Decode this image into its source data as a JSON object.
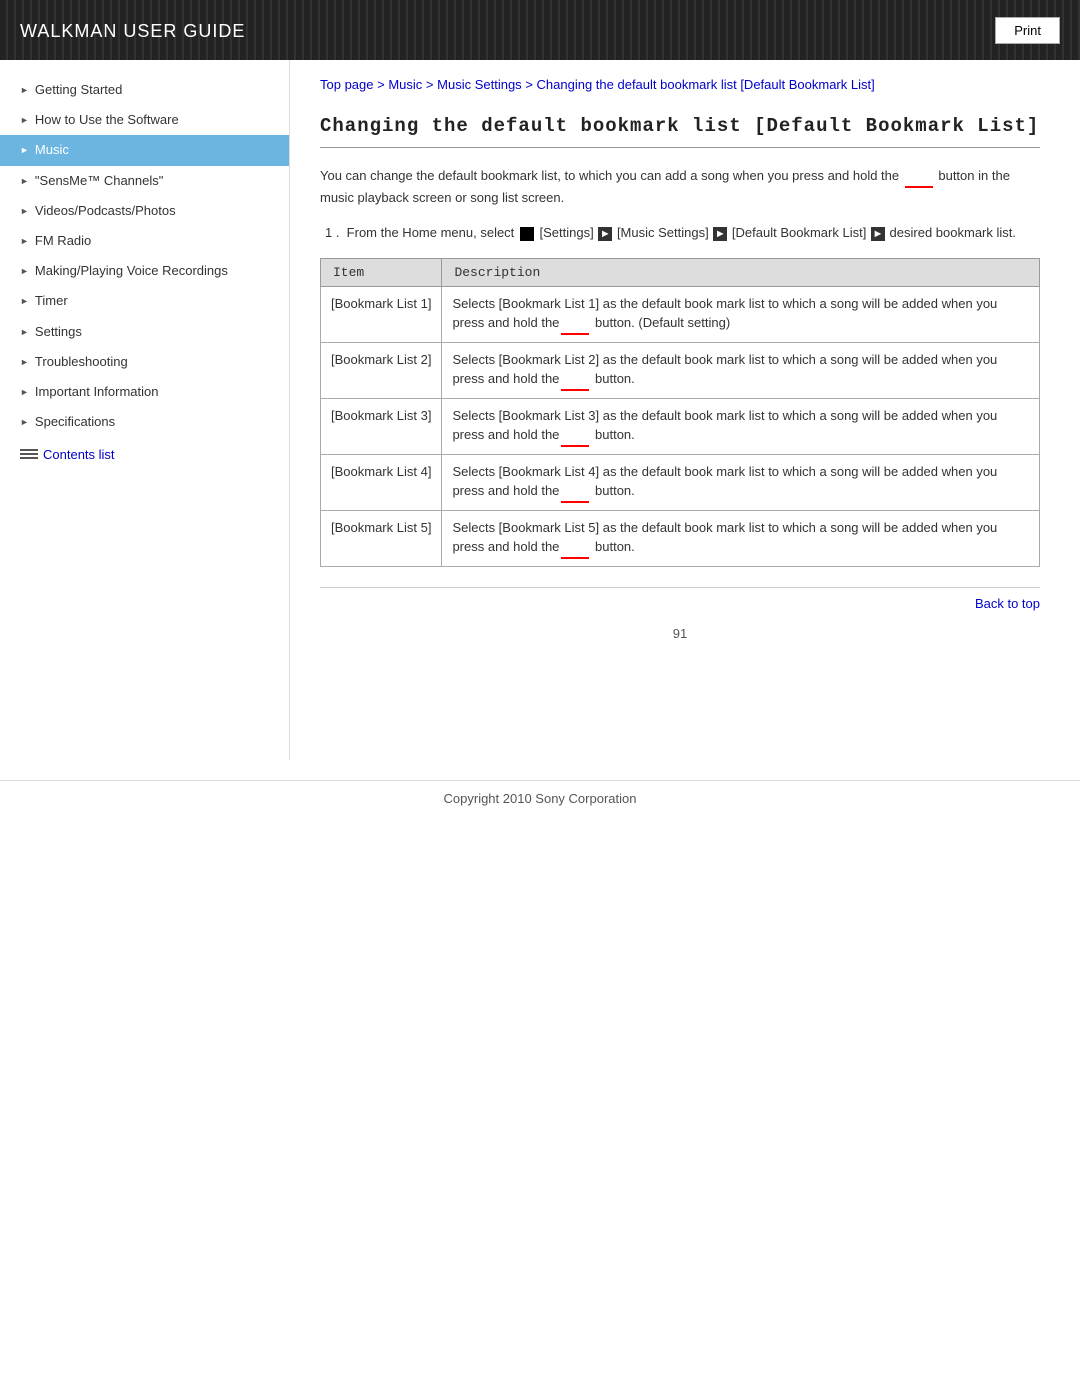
{
  "header": {
    "title": "WALKMAN",
    "subtitle": " User Guide",
    "print_label": "Print"
  },
  "sidebar": {
    "items": [
      {
        "id": "getting-started",
        "label": "Getting Started",
        "active": false
      },
      {
        "id": "how-to-use",
        "label": "How to Use the Software",
        "active": false
      },
      {
        "id": "music",
        "label": "Music",
        "active": true
      },
      {
        "id": "sensme",
        "label": "\"SensMe™ Channels\"",
        "active": false
      },
      {
        "id": "videos",
        "label": "Videos/Podcasts/Photos",
        "active": false
      },
      {
        "id": "fm-radio",
        "label": "FM Radio",
        "active": false
      },
      {
        "id": "voice",
        "label": "Making/Playing Voice Recordings",
        "active": false
      },
      {
        "id": "timer",
        "label": "Timer",
        "active": false
      },
      {
        "id": "settings",
        "label": "Settings",
        "active": false
      },
      {
        "id": "troubleshooting",
        "label": "Troubleshooting",
        "active": false
      },
      {
        "id": "important-info",
        "label": "Important Information",
        "active": false
      },
      {
        "id": "specifications",
        "label": "Specifications",
        "active": false
      }
    ],
    "contents_link": "Contents list"
  },
  "breadcrumb": {
    "parts": [
      "Top page",
      "Music",
      "Music Settings",
      "Changing the default bookmark list [Default Bookmark List]"
    ],
    "separator": " > "
  },
  "page": {
    "title": "Changing the default bookmark list [Default Bookmark List]",
    "intro": "You can change the default bookmark list, to which you can add a song when you press and hold the       button in the music playback screen or song list screen.",
    "step1": "1 .  From the Home menu, select   [Settings]   [Music Settings]   [Default Bookmark List]   desired bookmark list.",
    "table_header_item": "Item",
    "table_header_desc": "Description",
    "table_rows": [
      {
        "item": "[Bookmark List 1]",
        "description": "Selects [Bookmark List 1] as the default book mark list to which a song will be added when you press and hold the       button. (Default setting)"
      },
      {
        "item": "[Bookmark List 2]",
        "description": "Selects [Bookmark List 2] as the default book mark list to which a song will be added when you press and hold the       button."
      },
      {
        "item": "[Bookmark List 3]",
        "description": "Selects [Bookmark List 3] as the default book mark list to which a song will be added when you press and hold the       button."
      },
      {
        "item": "[Bookmark List 4]",
        "description": "Selects [Bookmark List 4] as the default book mark list to which a song will be added when you press and hold the       button."
      },
      {
        "item": "[Bookmark List 5]",
        "description": "Selects [Bookmark List 5] as the default book mark list to which a song will be added when you press and hold the       button."
      }
    ],
    "back_to_top": "Back to top",
    "copyright": "Copyright 2010 Sony Corporation",
    "page_number": "91"
  },
  "colors": {
    "header_bg": "#222222",
    "active_sidebar": "#6bb5e0",
    "link_color": "#0000cc",
    "red_underline": "#ff0000",
    "table_header_bg": "#dddddd"
  }
}
